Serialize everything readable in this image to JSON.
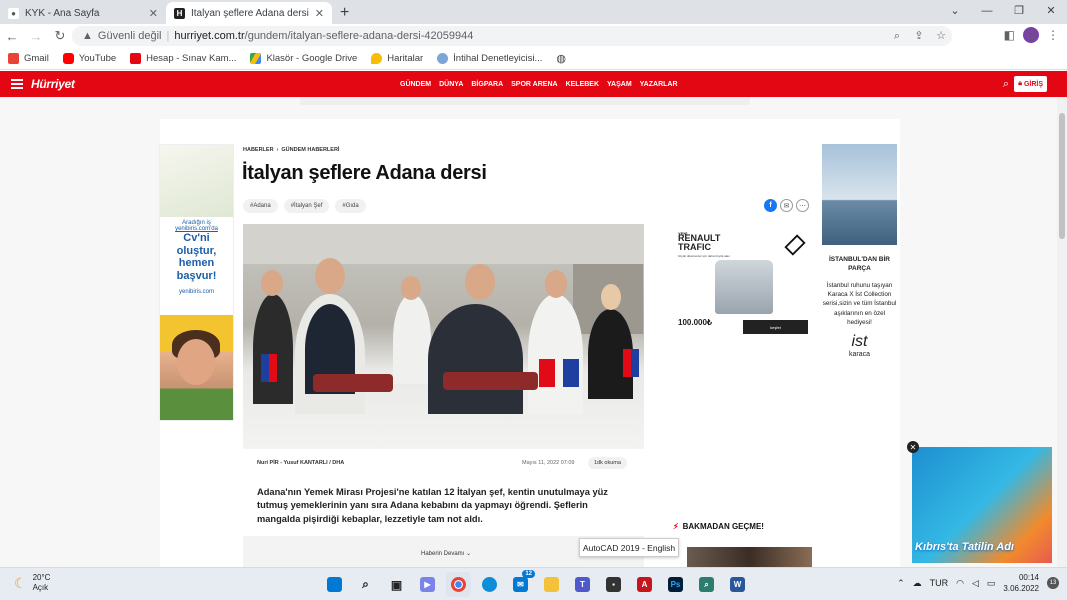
{
  "browser": {
    "tabs": [
      {
        "label": "KYK - Ana Sayfa",
        "active": false
      },
      {
        "label": "İtalyan şeflere Adana dersi - Son",
        "active": true
      }
    ],
    "new_tab": "+",
    "address": {
      "security": "Güvenli değil",
      "host": "hurriyet.com.tr",
      "path": "/gundem/italyan-seflere-adana-dersi-42059944"
    },
    "profile_initial": "G",
    "bookmarks": [
      {
        "label": "Gmail",
        "color": "#ea4335"
      },
      {
        "label": "YouTube",
        "color": "#ff0000"
      },
      {
        "label": "Hesap - Sınav Kam...",
        "color": "#e30613"
      },
      {
        "label": "Klasör - Google Drive",
        "color": "#34a853"
      },
      {
        "label": "Haritalar",
        "color": "#fbbc04"
      },
      {
        "label": "İntihal Denetleyicisi...",
        "color": "#7aa7d8"
      }
    ]
  },
  "site": {
    "logo": "Hürriyet",
    "menu": [
      "GÜNDEM",
      "DÜNYA",
      "BİGPARA",
      "SPOR ARENA",
      "KELEBEK",
      "YAŞAM",
      "YAZARLAR"
    ],
    "login": "GİRİŞ",
    "accent": "#e30613"
  },
  "article": {
    "breadcrumb": [
      "HABERLER",
      "GÜNDEM HABERLERİ"
    ],
    "title": "İtalyan şeflere Adana dersi",
    "tags": [
      "#Adana",
      "#İtalyan Şef",
      "#Gıda"
    ],
    "author": "Nuri PİR - Yusuf KANTARLI / DHA",
    "date": "Mayıs 11, 2022 07:09",
    "read_time": "1dk okuma",
    "lead": "Adana'nın Yemek Mirası Projesi'ne katılan 12 İtalyan şef, kentin unutulmaya yüz tutmuş yemeklerinin yanı sıra Adana kebabını da yapmayı öğrendi. Şeflerin mangalda pişirdiği kebaplar, lezzetiyle tam not aldı.",
    "continue_label": "Haberin Devamı ⌄"
  },
  "ads": {
    "left": {
      "line1": "Aradığın iş",
      "line2": "yenibiris.com'da",
      "headline": "Cv'ni oluştur, hemen başvur!",
      "brand": "yenibiris.com"
    },
    "renault": {
      "kicker": "YENİ",
      "title": "RENAULT TRAFIC",
      "small": "büyük düşünenler için daha büyük alan",
      "price": "100.000₺",
      "button": "keşfet"
    },
    "right": {
      "title": "İSTANBUL'DAN BİR PARÇA",
      "body": "İstanbul ruhunu taşıyan Karaca X İst Collection serisi,sizin ve tüm İstanbul aşıklarının en özel hediyesi!",
      "mono": "ist",
      "brand": "karaca"
    },
    "video_caption": "Kıbrıs'ta Tatilin Adı"
  },
  "section_heading": "BAKMADAN GEÇME!",
  "tooltip": "AutoCAD 2019 - English",
  "taskbar": {
    "weather_temp": "20°C",
    "weather_desc": "Açık",
    "mail_badge": "12",
    "lang": "TUR",
    "time": "00:14",
    "date": "3.06.2022",
    "notif": "13"
  }
}
